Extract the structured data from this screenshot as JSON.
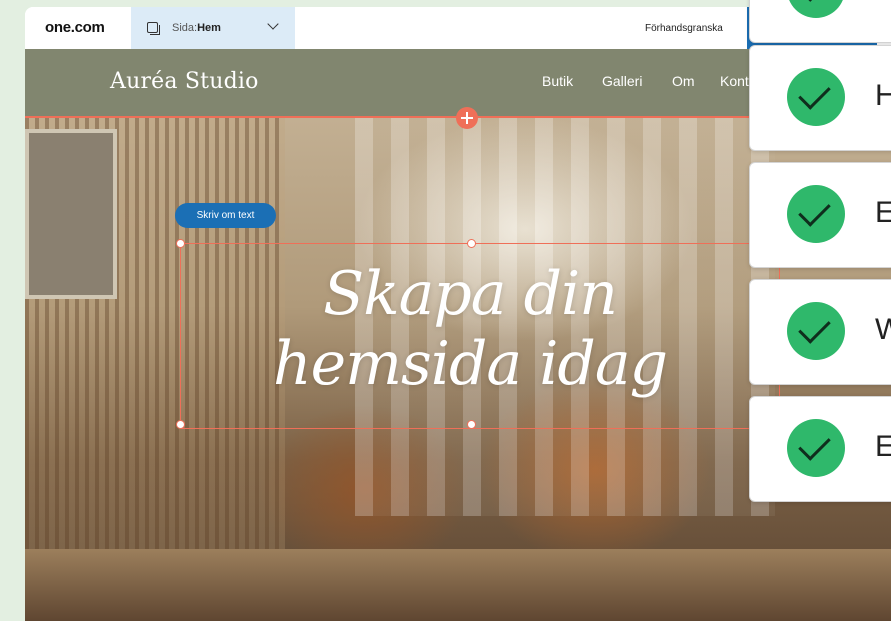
{
  "editor": {
    "logo": "one.com",
    "page_select": {
      "prefix": "Sida:",
      "value": "Hem"
    },
    "preview_label": "Förhandsgranska"
  },
  "site": {
    "brand": "Auréa Studio",
    "nav": [
      "Butik",
      "Galleri",
      "Om",
      "Kont"
    ],
    "rewrite_button": "Skriv om text",
    "headline": [
      "Skapa din",
      "hemsida idag"
    ]
  },
  "checklist": [
    {
      "text": ""
    },
    {
      "text": "H"
    },
    {
      "text": "E"
    },
    {
      "text": "W"
    },
    {
      "text": "E"
    }
  ],
  "colors": {
    "accent_blue": "#1b6fb5",
    "selection": "#ef6f58",
    "nav_bg": "#81866f",
    "check_green": "#2fb86b"
  }
}
